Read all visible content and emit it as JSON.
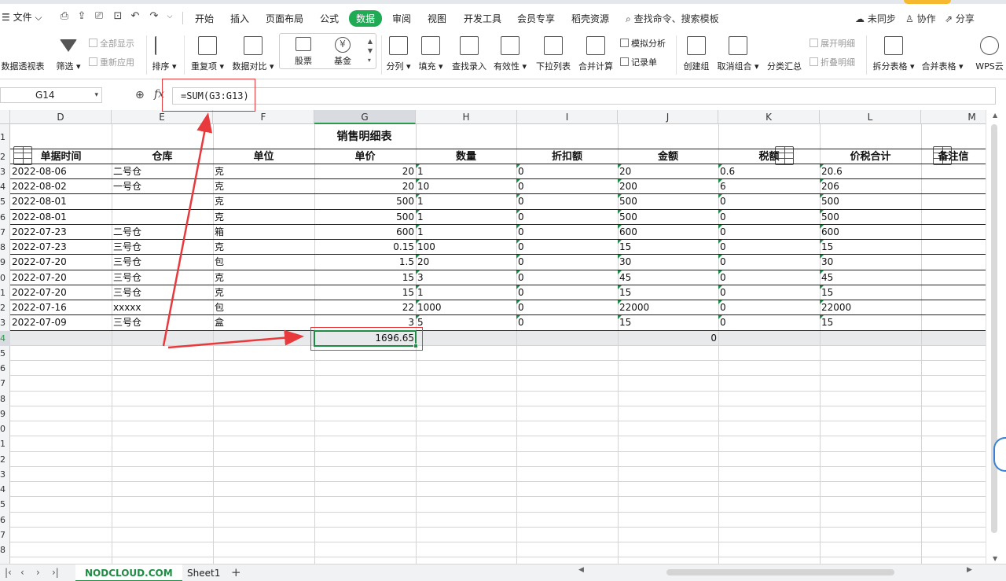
{
  "menu": {
    "file": "☰ 文件 ⌵",
    "tabs": [
      "开始",
      "插入",
      "页面布局",
      "公式",
      "数据",
      "审阅",
      "视图",
      "开发工具",
      "会员专享",
      "稻壳资源"
    ],
    "active_tab": "数据",
    "search": "查找命令、搜索模板",
    "sync": "未同步",
    "collab": "协作",
    "share": "分享"
  },
  "ribbon": {
    "pivot": "数据透视表",
    "filter": "筛选",
    "show_all": "全部显示",
    "reapply": "重新应用",
    "sort": "排序",
    "duplicates": "重复项",
    "compare": "数据对比",
    "stock": "股票",
    "fund": "基金",
    "split_col": "分列",
    "fill": "填充",
    "lookup": "查找录入",
    "validity": "有效性",
    "dropdown": "下拉列表",
    "consolidate": "合并计算",
    "simulate": "模拟分析",
    "record": "记录单",
    "group": "创建组",
    "ungroup": "取消组合",
    "subtotal": "分类汇总",
    "expand": "展开明细",
    "collapse": "折叠明细",
    "split_table": "拆分表格",
    "merge_table": "合并表格",
    "wps_cloud": "WPS云"
  },
  "formula_bar": {
    "name_box": "G14",
    "fx": "fx",
    "formula": "=SUM(G3:G13)"
  },
  "sheet": {
    "columns": [
      "D",
      "E",
      "F",
      "G",
      "H",
      "I",
      "J",
      "K",
      "L",
      "M"
    ],
    "selected_column": "G",
    "row_numbers": [
      "1",
      "2",
      "3",
      "4",
      "5",
      "6",
      "7",
      "8",
      "9",
      "0",
      "1",
      "2",
      "3",
      "4",
      "5",
      "6",
      "7",
      "8",
      "9",
      "0",
      "1",
      "2",
      "3",
      "4",
      "5",
      "6",
      "7",
      "8",
      "9"
    ],
    "title": "销售明细表",
    "headers": [
      "单据时间",
      "仓库",
      "单位",
      "单价",
      "数量",
      "折扣额",
      "金额",
      "税额",
      "价税合计",
      "备注信"
    ],
    "rows": [
      [
        "2022-08-06",
        "二号仓",
        "克",
        "20",
        "1",
        "0",
        "20",
        "0.6",
        "20.6"
      ],
      [
        "2022-08-02",
        "一号仓",
        "克",
        "20",
        "10",
        "0",
        "200",
        "6",
        "206"
      ],
      [
        "2022-08-01",
        "",
        "克",
        "500",
        "1",
        "0",
        "500",
        "0",
        "500"
      ],
      [
        "2022-08-01",
        "",
        "克",
        "500",
        "1",
        "0",
        "500",
        "0",
        "500"
      ],
      [
        "2022-07-23",
        "二号仓",
        "箱",
        "600",
        "1",
        "0",
        "600",
        "0",
        "600"
      ],
      [
        "2022-07-23",
        "三号仓",
        "克",
        "0.15",
        "100",
        "0",
        "15",
        "0",
        "15"
      ],
      [
        "2022-07-20",
        "三号仓",
        "包",
        "1.5",
        "20",
        "0",
        "30",
        "0",
        "30"
      ],
      [
        "2022-07-20",
        "三号仓",
        "克",
        "15",
        "3",
        "0",
        "45",
        "0",
        "45"
      ],
      [
        "2022-07-20",
        "三号仓",
        "克",
        "15",
        "1",
        "0",
        "15",
        "0",
        "15"
      ],
      [
        "2022-07-16",
        "xxxxx",
        "包",
        "22",
        "1000",
        "0",
        "22000",
        "0",
        "22000"
      ],
      [
        "2022-07-09",
        "三号仓",
        "盒",
        "3",
        "5",
        "0",
        "15",
        "0",
        "15"
      ]
    ],
    "total_price": "1696.65",
    "total_amount": "0"
  },
  "bottom": {
    "watermark_tab": "NODCLOUD.COM",
    "sheet_tab": "Sheet1",
    "add": "+"
  }
}
